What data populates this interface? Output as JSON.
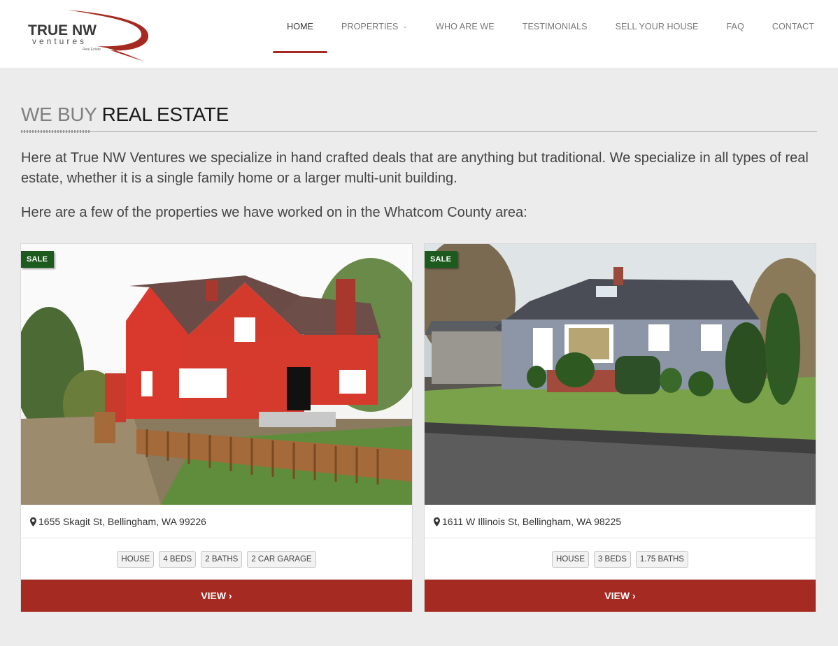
{
  "logo": {
    "main_text": "TRUE NW",
    "sub_text": "ventures",
    "tagline": "Real Estate"
  },
  "nav": {
    "items": [
      {
        "label": "HOME",
        "active": true
      },
      {
        "label": "PROPERTIES",
        "dropdown": true
      },
      {
        "label": "WHO ARE WE"
      },
      {
        "label": "TESTIMONIALS"
      },
      {
        "label": "SELL YOUR HOUSE"
      },
      {
        "label": "FAQ"
      },
      {
        "label": "CONTACT"
      }
    ]
  },
  "section": {
    "title_light": "WE BUY ",
    "title_dark": "REAL ESTATE",
    "intro": "Here at True NW Ventures we specialize in hand crafted deals that are anything but traditional. We specialize in all types of real estate, whether it is a single family home or a larger multi-unit building.",
    "intro2": "Here are a few of the properties we have worked on in the Whatcom County area:"
  },
  "properties": [
    {
      "badge": "SALE",
      "address": "1655 Skagit St, Bellingham, WA 99226",
      "tags": [
        "HOUSE",
        "4 BEDS",
        "2 BATHS",
        "2 CAR GARAGE"
      ],
      "button": "VIEW",
      "photo_icon": "red-house-photo"
    },
    {
      "badge": "SALE",
      "address": "1611 W Illinois St, Bellingham, WA 98225",
      "tags": [
        "HOUSE",
        "3 BEDS",
        "1.75 BATHS"
      ],
      "button": "VIEW",
      "photo_icon": "grey-house-photo"
    }
  ],
  "colors": {
    "accent": "#a52a21",
    "badge": "#1d5a1e",
    "background": "#ececec"
  }
}
